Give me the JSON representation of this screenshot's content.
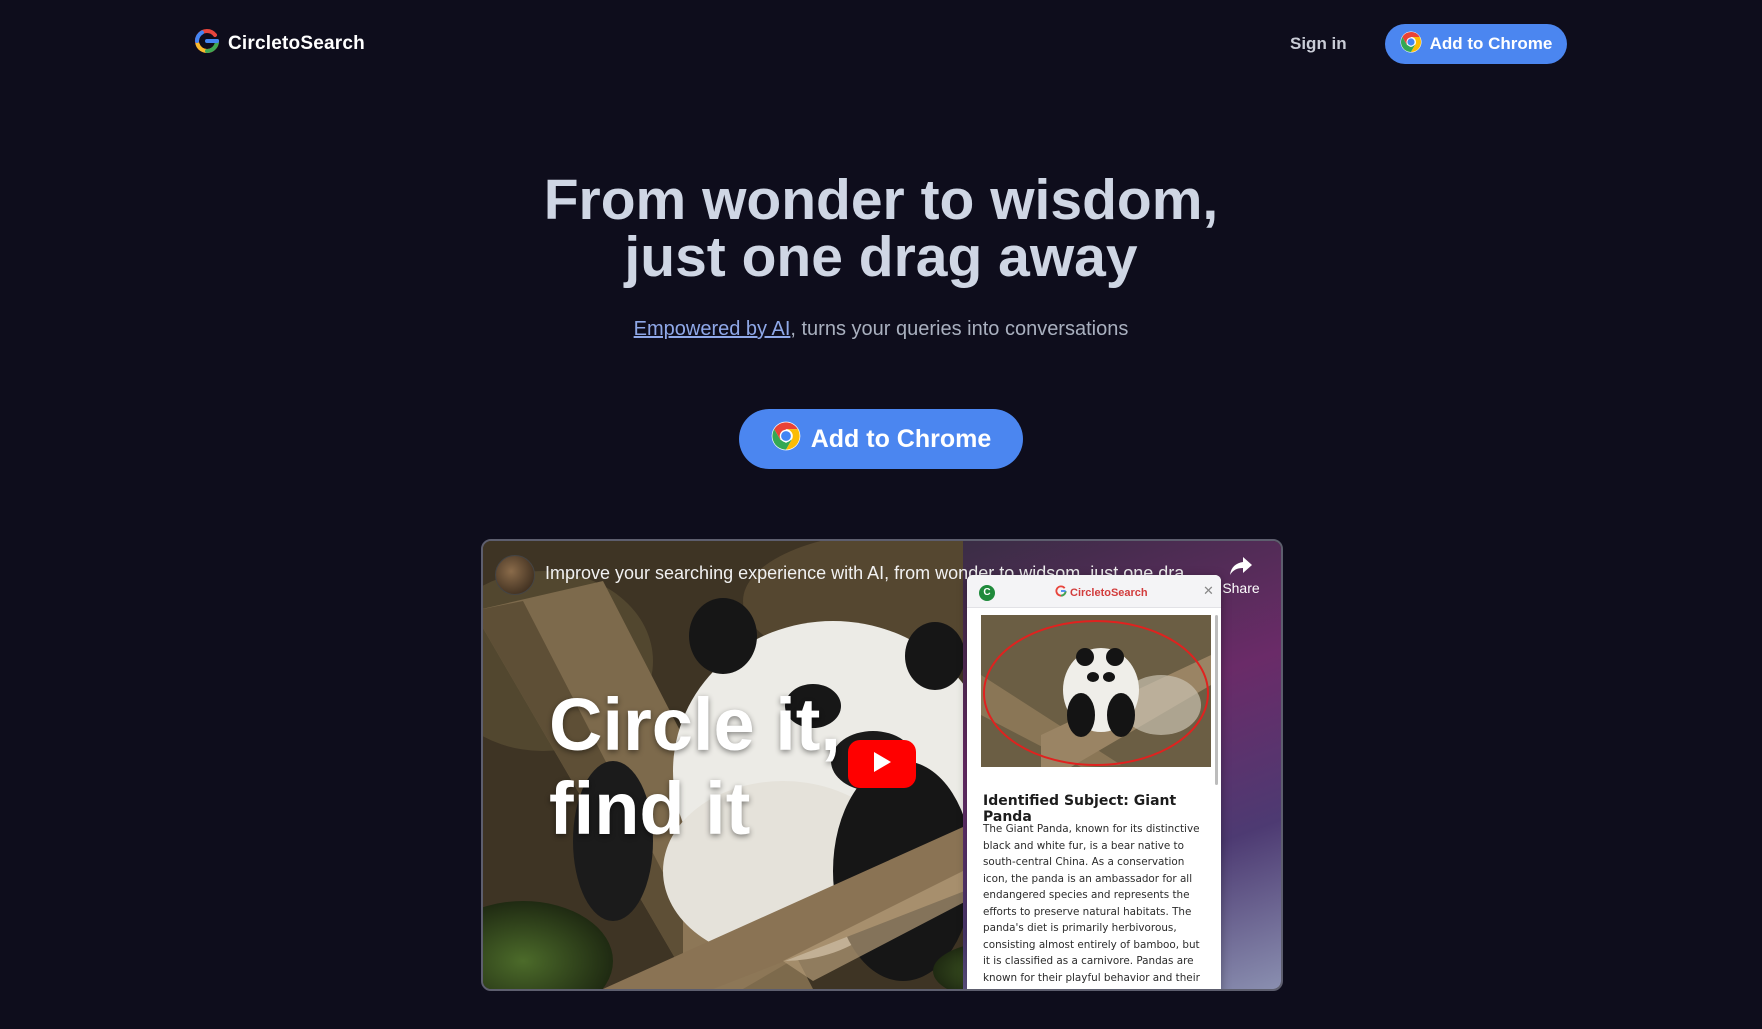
{
  "header": {
    "brand": "CircletoSearch",
    "sign_in": "Sign in",
    "cta": "Add to Chrome"
  },
  "hero": {
    "title_line1": "From wonder to wisdom,",
    "title_line2": "just one drag away",
    "subtitle_link": "Empowered by AI",
    "subtitle_rest": ", turns your queries into conversations",
    "cta": "Add to Chrome"
  },
  "video": {
    "title": "Improve your searching experience with AI, from wonder to widsom, just one dra...",
    "share_label": "Share",
    "overlay_line1": "Circle it,",
    "overlay_line2": "find it",
    "card": {
      "brand": "CircletoSearch",
      "badge": "C",
      "title": "Identified Subject: Giant Panda",
      "body": "The Giant Panda, known for its distinctive black and white fur, is a bear native to south-central China. As a conservation icon, the panda is an ambassador for all endangered species and represents the efforts to preserve natural habitats. The panda's diet is primarily herbivorous, consisting almost entirely of bamboo, but it is classified as a carnivore. Pandas are known for their playful behavior and their significance in Chinese culture as a symbol of peace and friendship."
    }
  },
  "colors": {
    "background": "#0e0d1c",
    "accent": "#4b86f0",
    "play_red": "#ff0000"
  }
}
